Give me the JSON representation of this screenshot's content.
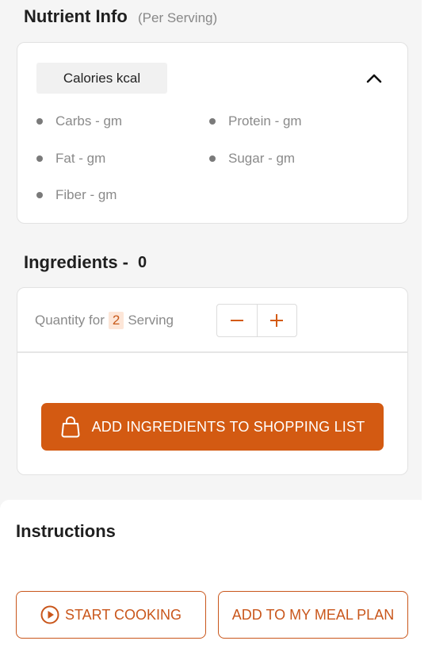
{
  "nutrient": {
    "title": "Nutrient Info",
    "subtitle": "(Per Serving)",
    "calories_label": "Calories  kcal",
    "items": [
      {
        "label": "Carbs - gm"
      },
      {
        "label": "Protein - gm"
      },
      {
        "label": "Fat - gm"
      },
      {
        "label": "Sugar - gm"
      },
      {
        "label": "Fiber - gm"
      }
    ]
  },
  "ingredients": {
    "title": "Ingredients -",
    "count": "0",
    "quantity_prefix": "Quantity for",
    "quantity_value": "2",
    "quantity_suffix": "Serving",
    "shopping_button": "ADD INGREDIENTS TO SHOPPING LIST"
  },
  "instructions": {
    "title": "Instructions",
    "start_button": "START COOKING",
    "meal_plan_button": "ADD TO MY MEAL PLAN"
  },
  "colors": {
    "accent": "#d35a12",
    "accent_outline": "#c9561b",
    "highlight_bg": "#fde6d8"
  },
  "icons": {
    "collapse": "chevron-up-icon",
    "minus": "minus-icon",
    "plus": "plus-icon",
    "bag": "shopping-bag-icon",
    "play": "play-circle-icon"
  }
}
